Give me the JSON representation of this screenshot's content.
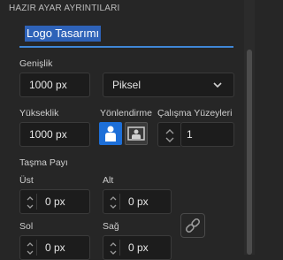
{
  "panel": {
    "section_title": "HAZIR AYAR AYRINTILARI",
    "preset_name": "Logo Tasarımı",
    "width": {
      "label": "Genişlik",
      "value": "1000 px"
    },
    "units": {
      "selected": "Piksel"
    },
    "height": {
      "label": "Yükseklik",
      "value": "1000 px"
    },
    "orientation": {
      "label": "Yönlendirme",
      "options": [
        "portrait-icon",
        "landscape-icon"
      ],
      "selected": "portrait"
    },
    "artboards": {
      "label": "Çalışma Yüzeyleri",
      "value": "1"
    },
    "bleed": {
      "label": "Taşma Payı",
      "top": {
        "label": "Üst",
        "value": "0 px"
      },
      "bottom": {
        "label": "Alt",
        "value": "0 px"
      },
      "left": {
        "label": "Sol",
        "value": "0 px"
      },
      "right": {
        "label": "Sağ",
        "value": "0 px"
      }
    }
  },
  "colors": {
    "background": "#262626",
    "accent": "#1d6fd8",
    "selection": "#2e62b8"
  }
}
